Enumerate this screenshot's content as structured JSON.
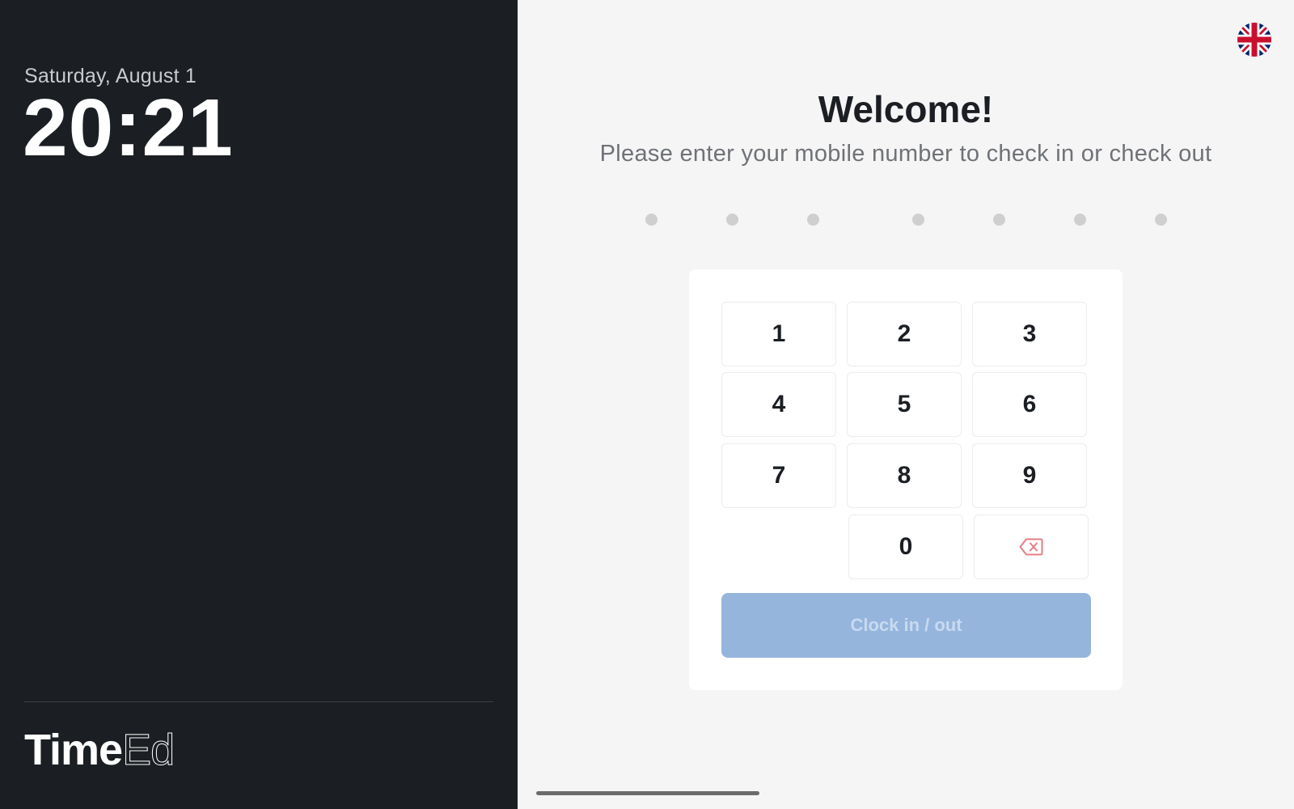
{
  "left_panel": {
    "date": "Saturday, August 1",
    "time": "20:21",
    "brand": {
      "bold_part": "Time",
      "light_part": "Ed"
    }
  },
  "right_panel": {
    "language_icon": "uk-flag-icon",
    "title": "Welcome!",
    "subtitle": "Please enter your mobile number to check in or check out",
    "pin_length": 7,
    "pin_filled": 0
  },
  "keypad": {
    "keys": [
      "1",
      "2",
      "3",
      "4",
      "5",
      "6",
      "7",
      "8",
      "9",
      "0"
    ],
    "backspace_icon": "backspace-icon",
    "submit_label": "Clock in / out"
  },
  "colors": {
    "left_background": "#1b1e22",
    "right_background": "#f5f5f5",
    "submit_disabled": "#95b5dd",
    "backspace_accent": "#e57c84",
    "pin_dot": "#cfcfcf"
  }
}
